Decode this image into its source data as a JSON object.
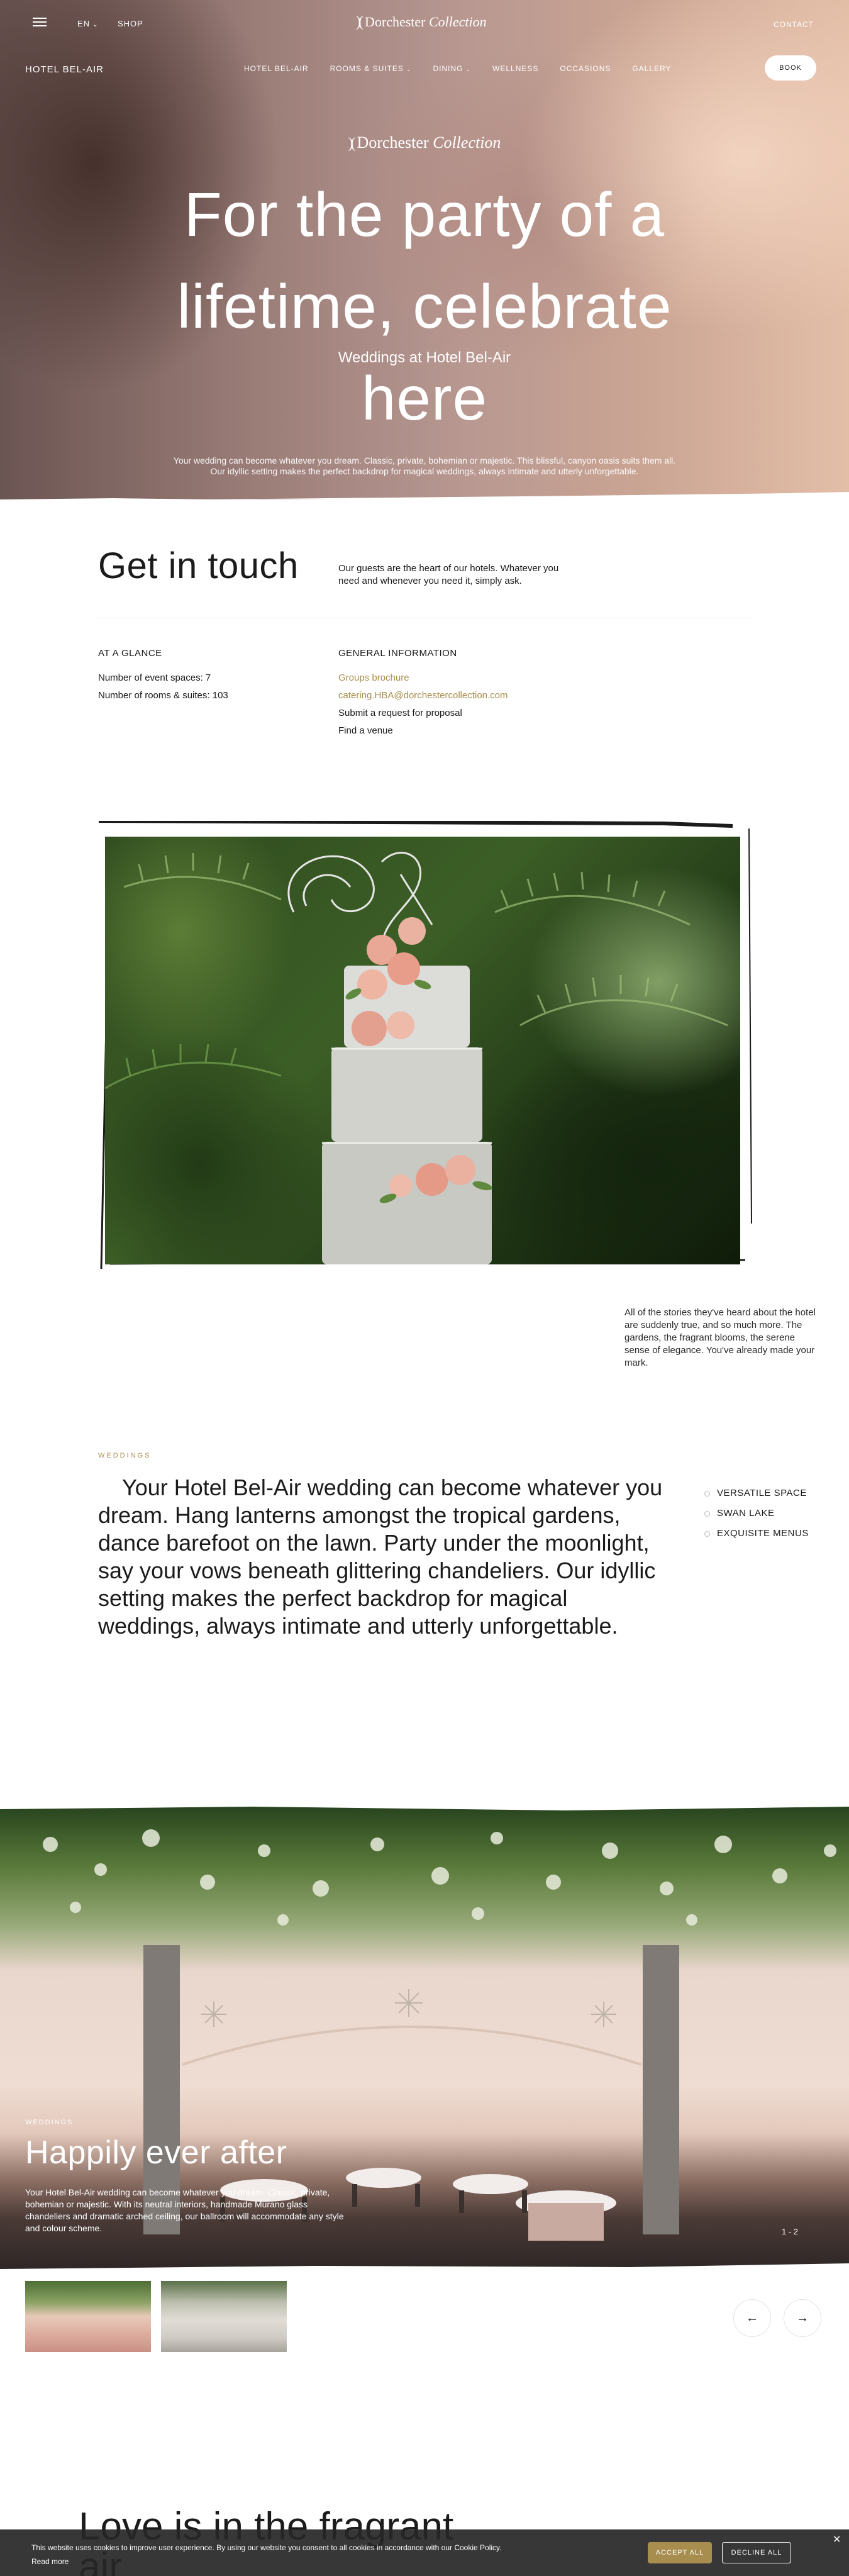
{
  "header": {
    "language": "EN",
    "shop_label": "SHOP",
    "brand_name": "Dorchester",
    "brand_name_italic": "Collection",
    "contact_label": "CONTACT"
  },
  "nav": {
    "hotel_name": "HOTEL BEL-AIR",
    "items": [
      {
        "label": "HOTEL BEL-AIR",
        "has_dropdown": false
      },
      {
        "label": "ROOMS & SUITES",
        "has_dropdown": true
      },
      {
        "label": "DINING",
        "has_dropdown": true
      },
      {
        "label": "WELLNESS",
        "has_dropdown": false
      },
      {
        "label": "OCCASIONS",
        "has_dropdown": false
      },
      {
        "label": "GALLERY",
        "has_dropdown": false
      }
    ],
    "book_label": "BOOK"
  },
  "hero": {
    "brand_name": "Dorchester",
    "brand_name_italic": "Collection",
    "title_line1": "For the party of a",
    "title_line2": "lifetime, celebrate here",
    "subtitle": "Weddings at Hotel Bel-Air",
    "description": "Your wedding can become whatever you dream. Classic, private, bohemian or majestic. This blissful, canyon oasis suits them all. Our idyllic setting makes the perfect backdrop for magical weddings, always intimate and utterly unforgettable."
  },
  "get_in_touch": {
    "title": "Get in touch",
    "description": "Our guests are the heart of our hotels. Whatever you need and whenever you need it, simply ask.",
    "glance_heading": "AT A GLANCE",
    "glance_items": [
      "Number of event spaces: 7",
      "Number of rooms & suites: 103"
    ],
    "general_heading": "GENERAL INFORMATION",
    "brochure_label": "Groups brochure",
    "email": "catering.HBA@dorchestercollection.com",
    "proposal_label": "Submit a request for proposal",
    "venue_label": "Find a venue"
  },
  "cake": {
    "caption": "All of the stories they've heard about the hotel are suddenly true, and so much more. The gardens, the fragrant blooms, the serene sense of elegance. You've already made your mark."
  },
  "weddings": {
    "eyebrow": "WEDDINGS",
    "text": "Your Hotel Bel-Air wedding can become whatever you dream. Hang lanterns amongst the tropical gardens, dance barefoot on the lawn. Party under the moonlight, say your vows beneath glittering chandeliers. Our idyllic setting makes the perfect backdrop for magical weddings, always intimate and utterly unforgettable.",
    "features": [
      "VERSATILE SPACE",
      "SWAN LAKE",
      "EXQUISITE MENUS"
    ]
  },
  "ballroom": {
    "eyebrow": "WEDDINGS",
    "title": "Happily ever after",
    "description": "Your Hotel Bel-Air wedding can become whatever you dream. Classic, private, bohemian or majestic. With its neutral interiors, handmade Murano glass chandeliers and dramatic arched ceiling, our ballroom will accommodate any style and colour scheme.",
    "counter": "1 - 2",
    "prev_icon": "arrow-left-icon",
    "next_icon": "arrow-right-icon"
  },
  "bottom": {
    "title_line1": "Love is in the fragrant",
    "title_line2": "air"
  },
  "cookie": {
    "text": "This website uses cookies to improve user experience. By using our website you consent to all cookies in accordance with our Cookie Policy.",
    "read_more": "Read more",
    "accept_label": "ACCEPT ALL",
    "decline_label": "DECLINE ALL",
    "close_icon": "close-icon"
  },
  "colors": {
    "accent_gold": "#a88e4e",
    "text_dark": "#1b1b1b",
    "cookie_bg": "#262626"
  }
}
